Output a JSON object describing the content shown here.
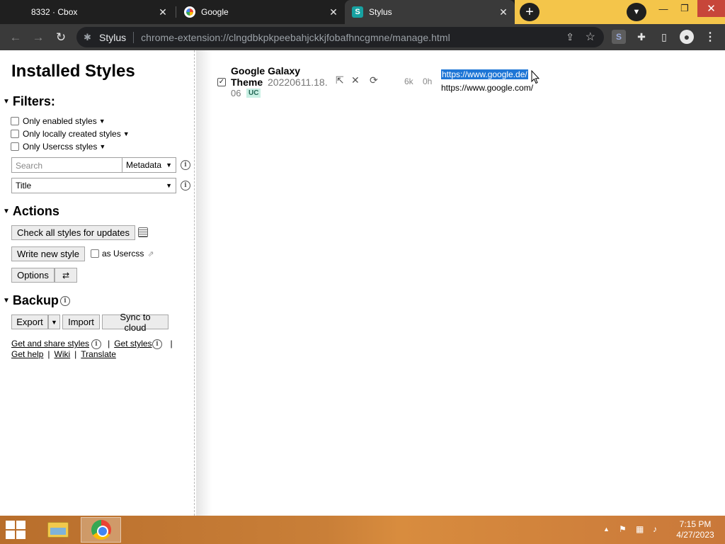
{
  "browser": {
    "tabs": [
      {
        "title": "8332 · Cbox",
        "active": false
      },
      {
        "title": "Google",
        "active": false
      },
      {
        "title": "Stylus",
        "active": true
      }
    ],
    "omnibox": {
      "site_chip": "Stylus",
      "url": "chrome-extension://clngdbkpkpeebahjckkjfobafhncgmne/manage.html"
    }
  },
  "sidebar": {
    "title": "Installed Styles",
    "filters": {
      "heading": "Filters:",
      "options": [
        {
          "label": "Only enabled styles",
          "checked": false
        },
        {
          "label": "Only locally created styles",
          "checked": false
        },
        {
          "label": "Only Usercss styles",
          "checked": false
        }
      ],
      "search_placeholder": "Search",
      "search_mode": "Metadata",
      "sort_by": "Title"
    },
    "actions": {
      "heading": "Actions",
      "check_updates_label": "Check all styles for updates",
      "write_new_label": "Write new style",
      "as_usercss_label": "as Usercss",
      "options_label": "Options"
    },
    "backup": {
      "heading": "Backup",
      "export_label": "Export",
      "import_label": "Import",
      "sync_label": "Sync to cloud"
    },
    "links": {
      "get_share": "Get and share styles",
      "get_styles": "Get styles",
      "get_help": "Get help",
      "wiki": "Wiki",
      "translate": "Translate"
    }
  },
  "styles": [
    {
      "name": "Google Galaxy Theme",
      "version_line1": "20220611.18.",
      "version_line2": "06",
      "badge": "UC",
      "size": "6k",
      "age": "0h",
      "applies_to": [
        "https://www.google.de/",
        "https://www.google.com/"
      ],
      "enabled": true
    }
  ],
  "taskbar": {
    "time": "7:15 PM",
    "date": "4/27/2023"
  },
  "colors": {
    "tab_strip_accent": "#f4c54a",
    "selection": "#1e76d6",
    "badge_bg": "#c9f0e4",
    "close_button": "#c7463a"
  }
}
